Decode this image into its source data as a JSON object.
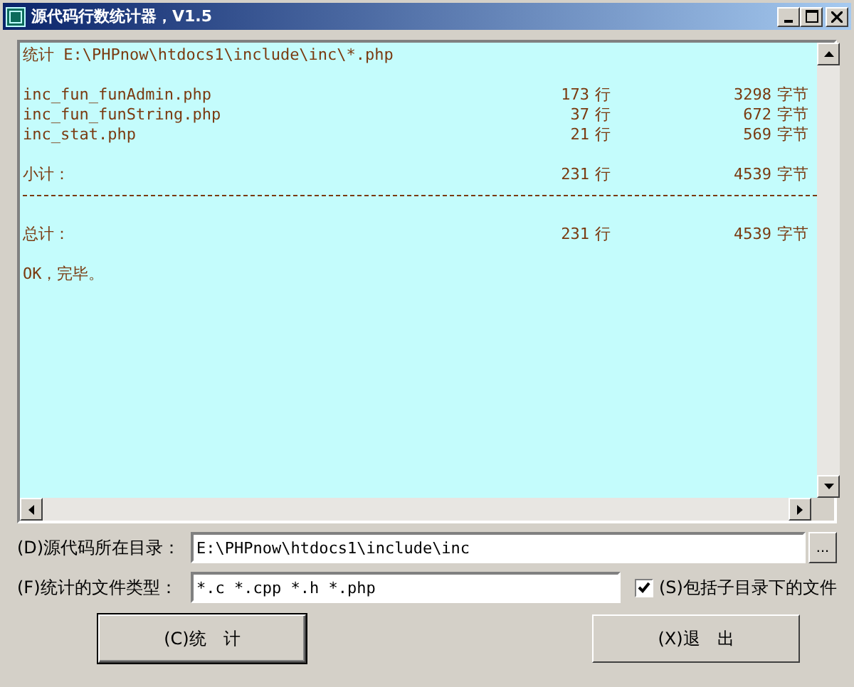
{
  "window": {
    "title": "源代码行数统计器，V1.5"
  },
  "output": {
    "lines": [
      {
        "kind": "text",
        "text": "统计 E:\\PHPnow\\htdocs1\\include\\inc\\*.php"
      },
      {
        "kind": "blank"
      },
      {
        "kind": "row",
        "name": "inc_fun_funAdmin.php",
        "count": "173",
        "count_unit": "行",
        "bytes": "3298",
        "bytes_unit": "字节"
      },
      {
        "kind": "row",
        "name": "inc_fun_funString.php",
        "count": "37",
        "count_unit": "行",
        "bytes": "672",
        "bytes_unit": "字节"
      },
      {
        "kind": "row",
        "name": "inc_stat.php",
        "count": "21",
        "count_unit": "行",
        "bytes": "569",
        "bytes_unit": "字节"
      },
      {
        "kind": "blank"
      },
      {
        "kind": "row",
        "name": "小计：",
        "count": "231",
        "count_unit": "行",
        "bytes": "4539",
        "bytes_unit": "字节"
      },
      {
        "kind": "rule"
      },
      {
        "kind": "blank"
      },
      {
        "kind": "row",
        "name": "总计：",
        "count": "231",
        "count_unit": "行",
        "bytes": "4539",
        "bytes_unit": "字节"
      },
      {
        "kind": "blank"
      },
      {
        "kind": "text",
        "text": "OK，完毕。"
      }
    ]
  },
  "directory": {
    "label": "(D)源代码所在目录：",
    "value": "E:\\PHPnow\\htdocs1\\include\\inc",
    "browse": "..."
  },
  "file_types": {
    "label": "(F)统计的文件类型：",
    "value": "*.c *.cpp *.h *.php"
  },
  "include_subdirs": {
    "label": "(S)包括子目录下的文件",
    "checked": true
  },
  "buttons": [
    {
      "label": "(C)统　计",
      "default": true
    },
    {
      "label": "(X)退　出",
      "default": false
    }
  ]
}
